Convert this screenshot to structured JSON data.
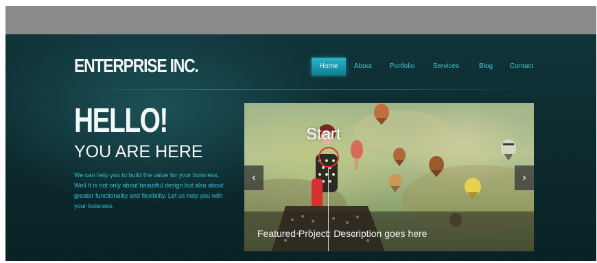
{
  "site": {
    "logo": "ENTERPRISE INC."
  },
  "nav": {
    "items": [
      {
        "label": "Home",
        "active": true
      },
      {
        "label": "About",
        "active": false
      },
      {
        "label": "Portfolio",
        "active": false
      },
      {
        "label": "Services",
        "active": false
      },
      {
        "label": "Blog",
        "active": false
      },
      {
        "label": "Contact",
        "active": false
      }
    ]
  },
  "hero": {
    "headline": "HELLO!",
    "subheadline": "YOU ARE HERE",
    "body": "We can help you to build the value for your buisness. Well It is not only about beautiful design but also about greater functionality and flexibility. Let us help you with your buisness."
  },
  "slider": {
    "overlay_label": "Start",
    "caption": "Featured Project: Description goes here",
    "prev_icon": "‹",
    "next_icon": "›"
  },
  "colors": {
    "accent": "#2dc3d3",
    "background": "#0a2a2e",
    "topbar": "#8a8a8a",
    "play_ring": "#d9342c"
  }
}
